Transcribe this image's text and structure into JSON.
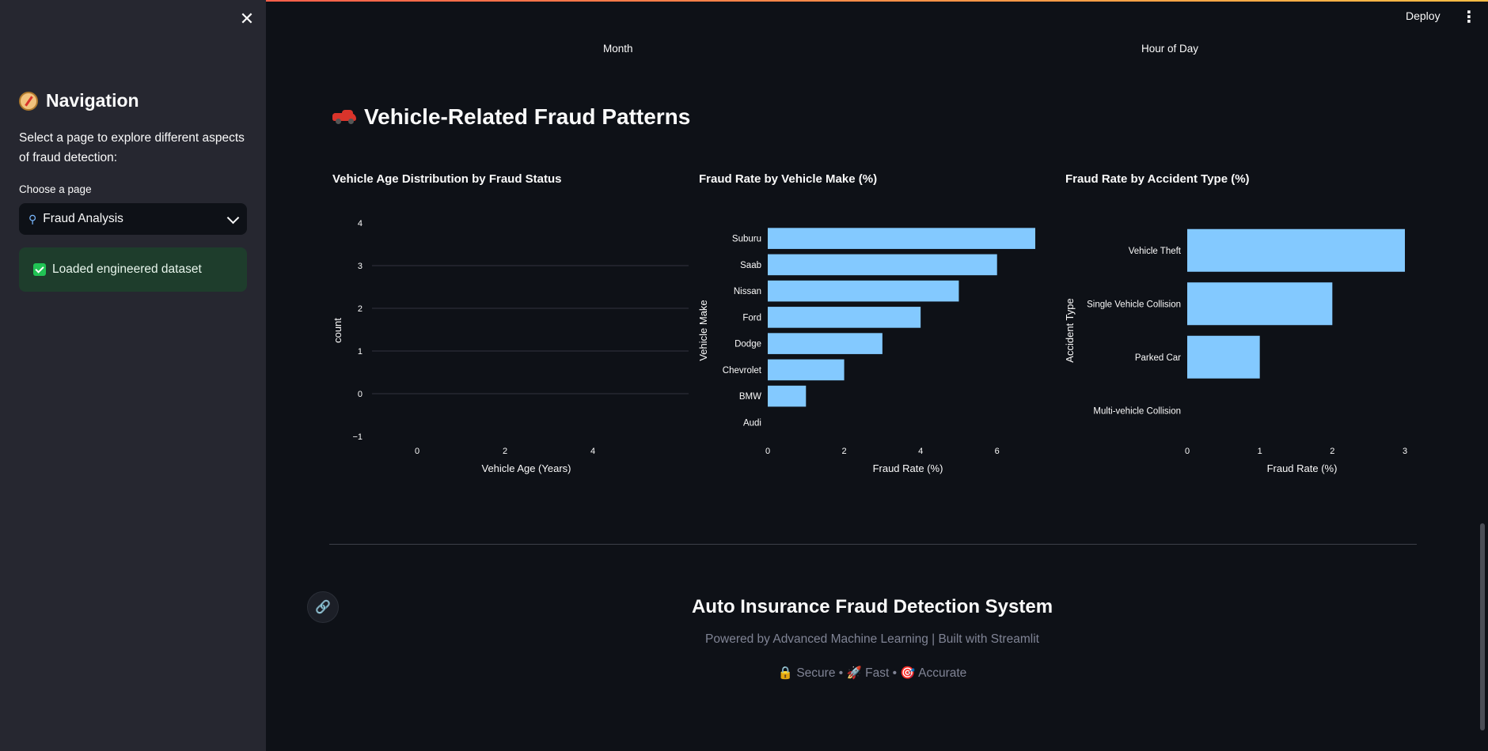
{
  "sidebar": {
    "nav_title": "Navigation",
    "nav_icon": "compass-icon",
    "description": "Select a page to explore different aspects of fraud detection:",
    "choose_label": "Choose a page",
    "select_value": "Fraud Analysis",
    "select_icon": "magnifier-icon",
    "success_message": "Loaded engineered dataset"
  },
  "header": {
    "deploy_label": "Deploy"
  },
  "top_axes": {
    "left": "Month",
    "right": "Hour of Day"
  },
  "section": {
    "title": "Vehicle-Related Fraud Patterns",
    "icon": "car-icon"
  },
  "chart_data": [
    {
      "type": "bar",
      "title": "Vehicle Age Distribution by Fraud Status",
      "xlabel": "Vehicle Age (Years)",
      "ylabel": "count",
      "x_ticks": [
        "0",
        "2",
        "4"
      ],
      "y_ticks": [
        "4",
        "3",
        "2",
        "1",
        "0",
        "−1"
      ],
      "ylim": [
        -1,
        4
      ],
      "values": [],
      "grid": true
    },
    {
      "type": "bar",
      "orientation": "horizontal",
      "title": "Fraud Rate by Vehicle Make (%)",
      "xlabel": "Fraud Rate (%)",
      "ylabel": "Vehicle Make",
      "categories": [
        "Suburu",
        "Saab",
        "Nissan",
        "Ford",
        "Dodge",
        "Chevrolet",
        "BMW",
        "Audi"
      ],
      "values": [
        7,
        6,
        5,
        4,
        3,
        2,
        1,
        0
      ],
      "x_ticks": [
        "0",
        "2",
        "4",
        "6"
      ],
      "xlim": [
        0,
        7
      ],
      "color": "#83c9ff"
    },
    {
      "type": "bar",
      "orientation": "horizontal",
      "title": "Fraud Rate by Accident Type (%)",
      "xlabel": "Fraud Rate (%)",
      "ylabel": "Accident Type",
      "categories": [
        "Vehicle Theft",
        "Single Vehicle Collision",
        "Parked Car",
        "Multi-vehicle Collision"
      ],
      "values": [
        3,
        2,
        1,
        0
      ],
      "x_ticks": [
        "0",
        "1",
        "2",
        "3"
      ],
      "xlim": [
        0,
        3
      ],
      "color": "#83c9ff"
    }
  ],
  "footer": {
    "title": "Auto Insurance Fraud Detection System",
    "subtitle": "Powered by Advanced Machine Learning | Built with Streamlit",
    "tag1": "Secure",
    "tag2": "Fast",
    "tag3": "Accurate",
    "separator": "•"
  },
  "colors": {
    "background": "#0e1117",
    "sidebar": "#262730",
    "bar": "#83c9ff",
    "success_bg": "#1e3d2c"
  }
}
